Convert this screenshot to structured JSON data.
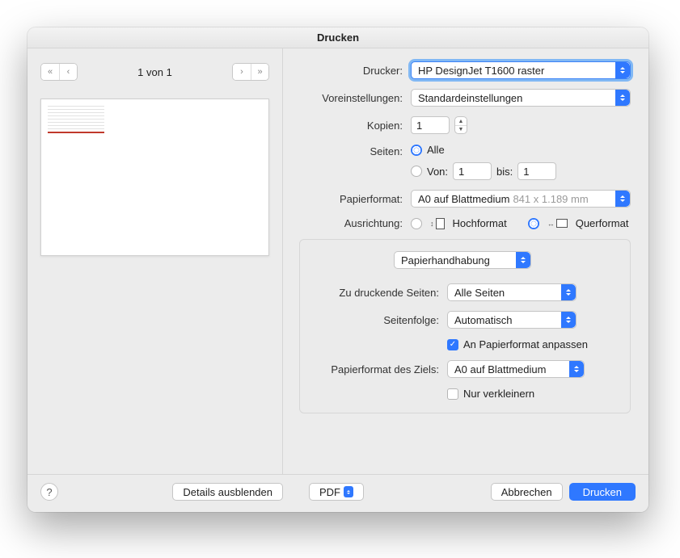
{
  "title": "Drucken",
  "pagenav": {
    "info": "1 von 1"
  },
  "labels": {
    "printer": "Drucker:",
    "presets": "Voreinstellungen:",
    "copies": "Kopien:",
    "pages": "Seiten:",
    "pages_all": "Alle",
    "pages_from": "Von:",
    "pages_to": "bis:",
    "paper": "Papierformat:",
    "orientation": "Ausrichtung:",
    "orient_portrait": "Hochformat",
    "orient_landscape": "Querformat"
  },
  "values": {
    "printer": "HP DesignJet T1600 raster",
    "presets": "Standardeinstellungen",
    "copies": "1",
    "pages_from": "1",
    "pages_to": "1",
    "paper_name": "A0 auf Blattmedium",
    "paper_dim": "841 x 1.189 mm"
  },
  "section": {
    "selected": "Papierhandhabung"
  },
  "handling": {
    "pages_label": "Zu druckende Seiten:",
    "pages_value": "Alle Seiten",
    "order_label": "Seitenfolge:",
    "order_value": "Automatisch",
    "fit_label": "An Papierformat anpassen",
    "target_label": "Papierformat des Ziels:",
    "target_value": "A0 auf Blattmedium",
    "shrink_label": "Nur verkleinern"
  },
  "footer": {
    "details": "Details ausblenden",
    "pdf": "PDF",
    "cancel": "Abbrechen",
    "print": "Drucken"
  }
}
